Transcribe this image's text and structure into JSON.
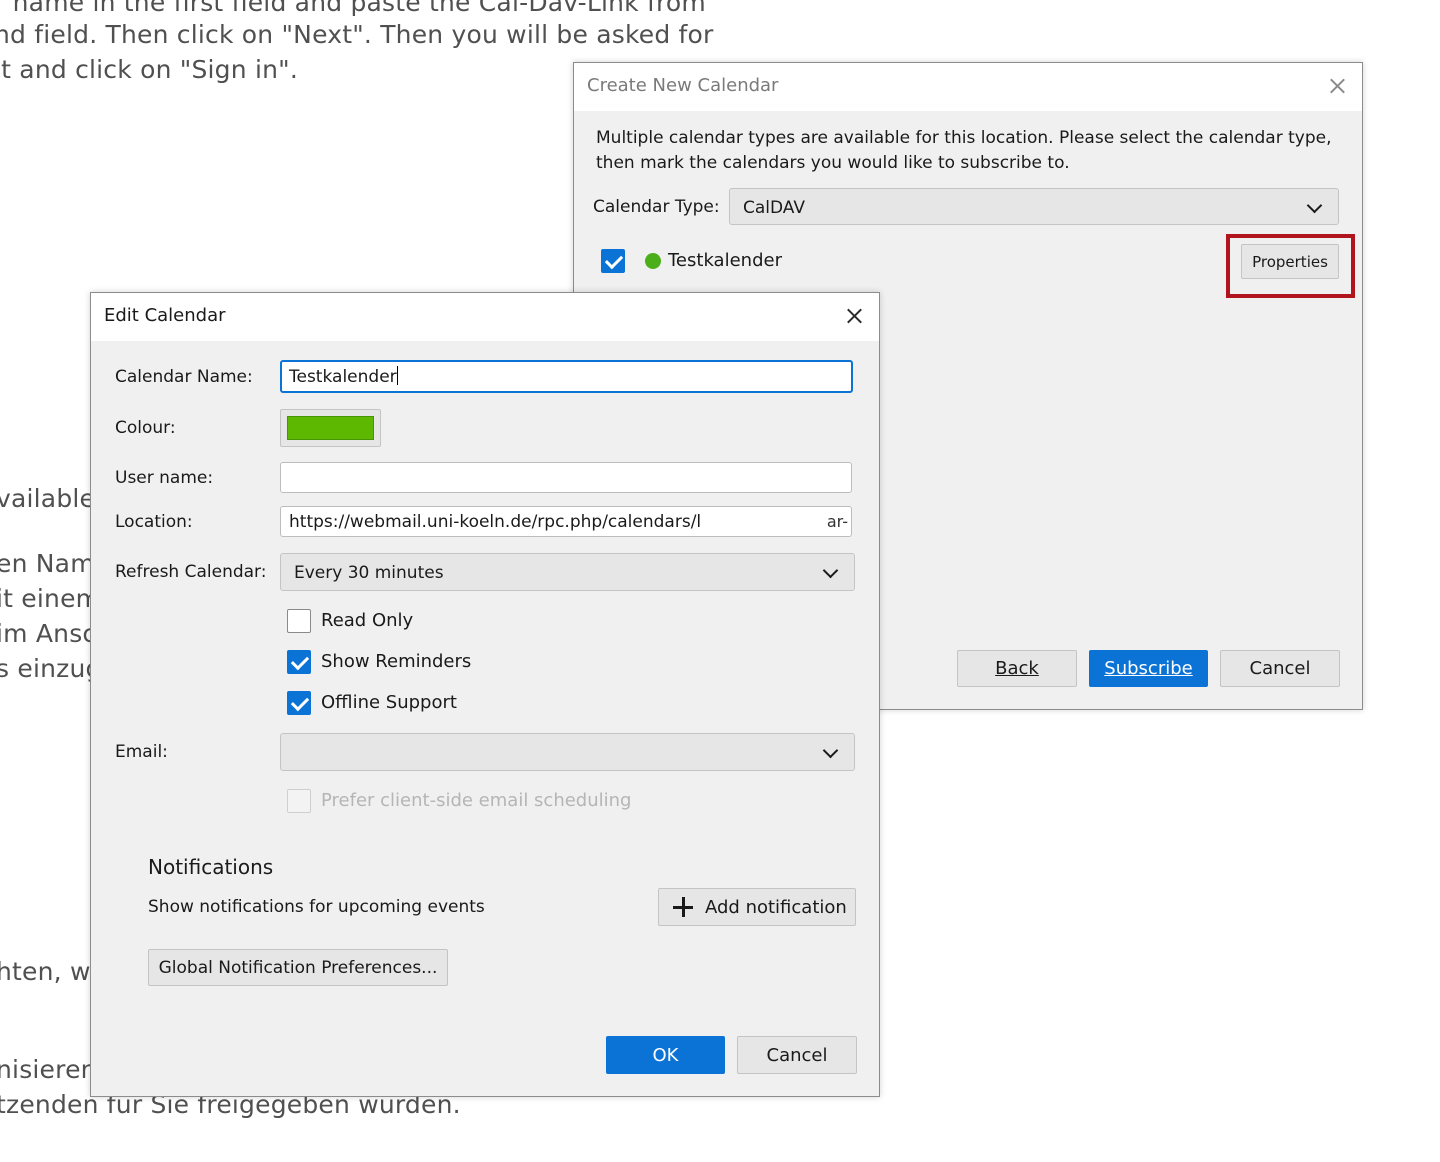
{
  "background_text": {
    "top_lines": [
      "r name in the first field and paste the Cal-Dav-Link from",
      "nd field. Then click on \"Next\". Then you will be asked for",
      "it and click on \"Sign in\"."
    ],
    "left_fragments": [
      "vailable",
      "en Name",
      "it einem",
      "im Ansc",
      "s einzug",
      "hten, wi",
      "nisieren"
    ],
    "bottom_line": "tzenden für Sie freigegeben wurden."
  },
  "create_dialog": {
    "title": "Create New Calendar",
    "description_line1": "Multiple calendar types are available for this location. Please select the calendar type,",
    "description_line2": "then mark the calendars you would like to subscribe to.",
    "type_label": "Calendar Type:",
    "type_value": "CalDAV",
    "calendar_item": {
      "name": "Testkalender",
      "checked": true,
      "color": "#4caf1a"
    },
    "properties_label": "Properties",
    "back_label": "Back",
    "subscribe_label": "Subscribe",
    "cancel_label": "Cancel"
  },
  "edit_dialog": {
    "title": "Edit Calendar",
    "name_label": "Calendar Name:",
    "name_value": "Testkalender",
    "colour_label": "Colour:",
    "colour_value": "#5cb800",
    "username_label": "User name:",
    "username_value": "",
    "location_label": "Location:",
    "location_value": "https://webmail.uni-koeln.de/rpc.php/calendars/l",
    "location_suffix": "ar-",
    "refresh_label": "Refresh Calendar:",
    "refresh_value": "Every 30 minutes",
    "read_only_label": "Read Only",
    "read_only_checked": false,
    "show_reminders_label": "Show Reminders",
    "show_reminders_checked": true,
    "offline_support_label": "Offline Support",
    "offline_support_checked": true,
    "email_label": "Email:",
    "email_value": "",
    "prefer_client_label": "Prefer client-side email scheduling",
    "notifications_heading": "Notifications",
    "notifications_desc": "Show notifications for upcoming events",
    "add_notification_label": "Add notification",
    "global_prefs_label": "Global Notification Preferences...",
    "ok_label": "OK",
    "cancel_label": "Cancel"
  },
  "colors": {
    "accent": "#0b73d6",
    "highlight": "#b0141c"
  }
}
